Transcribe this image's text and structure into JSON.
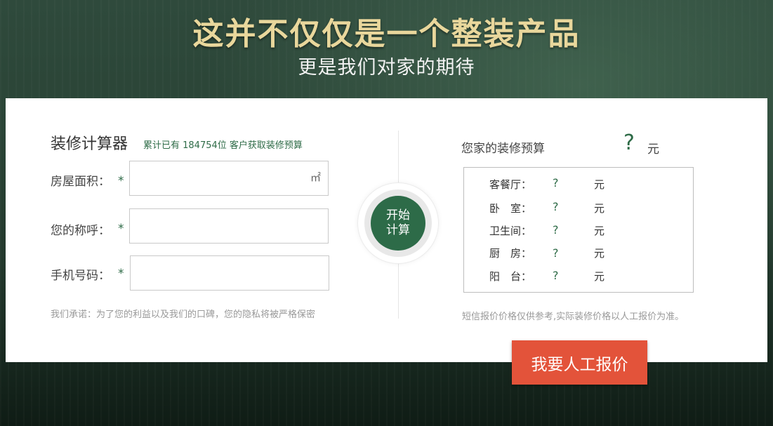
{
  "hero": {
    "title": "这并不仅仅是一个整装产品",
    "subtitle": "更是我们对家的期待"
  },
  "calculator": {
    "title": "装修计算器",
    "count_text": "累计已有 184754位 客户获取装修预算",
    "required_mark": "*",
    "fields": [
      {
        "label": "房屋面积：",
        "value": "",
        "unit": "㎡"
      },
      {
        "label": "您的称呼：",
        "value": ""
      },
      {
        "label": "手机号码：",
        "value": ""
      }
    ],
    "promise": "我们承诺：为了您的利益以及我们的口碑，您的隐私将被严格保密",
    "calc_button": {
      "line1": "开始",
      "line2": "计算"
    }
  },
  "budget": {
    "label": "您家的装修预算",
    "total": "?",
    "unit": "元",
    "rooms": [
      {
        "name": "客餐厅：",
        "value": "?",
        "unit": "元"
      },
      {
        "name": "卧　室：",
        "value": "?",
        "unit": "元"
      },
      {
        "name": "卫生间：",
        "value": "?",
        "unit": "元"
      },
      {
        "name": "厨　房：",
        "value": "?",
        "unit": "元"
      },
      {
        "name": "阳　台：",
        "value": "?",
        "unit": "元"
      }
    ],
    "disclaimer": "短信报价价格仅供参考,实际装修价格以人工报价为准。"
  },
  "manual_quote_button": "我要人工报价",
  "colors": {
    "accent_green": "#2d6b48",
    "button_orange": "#e3533a",
    "title_gold": "#e9d79c"
  }
}
